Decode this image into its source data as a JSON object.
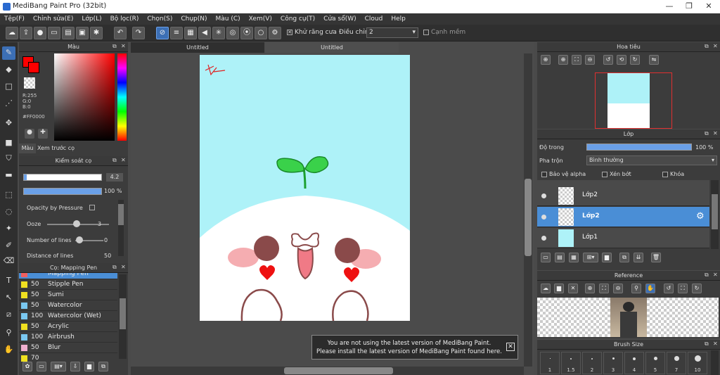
{
  "window": {
    "title": "MediBang Paint Pro (32bit)"
  },
  "menu": [
    "Tệp(F)",
    "Chỉnh sửa(E)",
    "Lớp(L)",
    "Bộ lọc(R)",
    "Chọn(S)",
    "Chụp(N)",
    "Màu (C)",
    "Xem(V)",
    "Công cụ(T)",
    "Cửa sổ(W)",
    "Cloud",
    "Help"
  ],
  "toolbar": {
    "antialias_label": "Khử răng cưa",
    "adjust_label": "Điều chỉnh",
    "adjust_value": "2",
    "smooth_label": "Cạnh mềm"
  },
  "color_panel": {
    "title": "Màu",
    "r": "R:255",
    "g": "G:0",
    "b": "B:0",
    "hex": "#FF0000",
    "tab_color": "Màu",
    "tab_preview": "Xem trước cọ",
    "primary_color": "#ff0000"
  },
  "brush_control": {
    "title": "Kiểm soát cọ",
    "size_value": "4.2",
    "opacity_value": "100 %",
    "opacity_pressure": "Opacity by Pressure",
    "ooze_label": "Ooze",
    "ooze_value": "3",
    "lines_label": "Number of lines",
    "lines_value": "0",
    "distance_label": "Distance of lines",
    "distance_value": "50"
  },
  "brush_list": {
    "title": "Cọ: Mapping Pen",
    "items": [
      {
        "size": "",
        "name": "Mapping Pen",
        "color": "#f06060"
      },
      {
        "size": "50",
        "name": "Stipple Pen",
        "color": "#f0e020"
      },
      {
        "size": "50",
        "name": "Sumi",
        "color": "#f0e020"
      },
      {
        "size": "50",
        "name": "Watercolor",
        "color": "#7ac8f0"
      },
      {
        "size": "100",
        "name": "Watercolor (Wet)",
        "color": "#7ac8f0"
      },
      {
        "size": "50",
        "name": "Acrylic",
        "color": "#f0e020"
      },
      {
        "size": "100",
        "name": "Airbrush",
        "color": "#7ac8f0"
      },
      {
        "size": "50",
        "name": "Blur",
        "color": "#f0b0d0"
      },
      {
        "size": "70",
        "name": "",
        "color": "#f0e020"
      }
    ]
  },
  "documents": {
    "tab1": "Untitled",
    "tab2": "Untitled"
  },
  "navigator": {
    "title": "Hoa tiêu"
  },
  "layers": {
    "title": "Lớp",
    "opacity_label": "Độ trong",
    "opacity_value": "100 %",
    "blend_label": "Pha trộn",
    "blend_value": "Bình thường",
    "protect_alpha": "Bảo vệ alpha",
    "clipping": "Xén bớt",
    "lock": "Khóa",
    "items": [
      {
        "name": "Lớp2",
        "selected": false
      },
      {
        "name": "Lớp2",
        "selected": true
      },
      {
        "name": "Lớp1",
        "selected": false
      }
    ]
  },
  "reference": {
    "title": "Reference"
  },
  "brush_size": {
    "title": "Brush Size",
    "sizes": [
      "1",
      "1.5",
      "2",
      "3",
      "4",
      "5",
      "7",
      "10"
    ]
  },
  "notice": {
    "line1": "You are not using the latest version of MediBang Paint.",
    "line2": "Please install the latest version of MediBang Paint found here."
  }
}
